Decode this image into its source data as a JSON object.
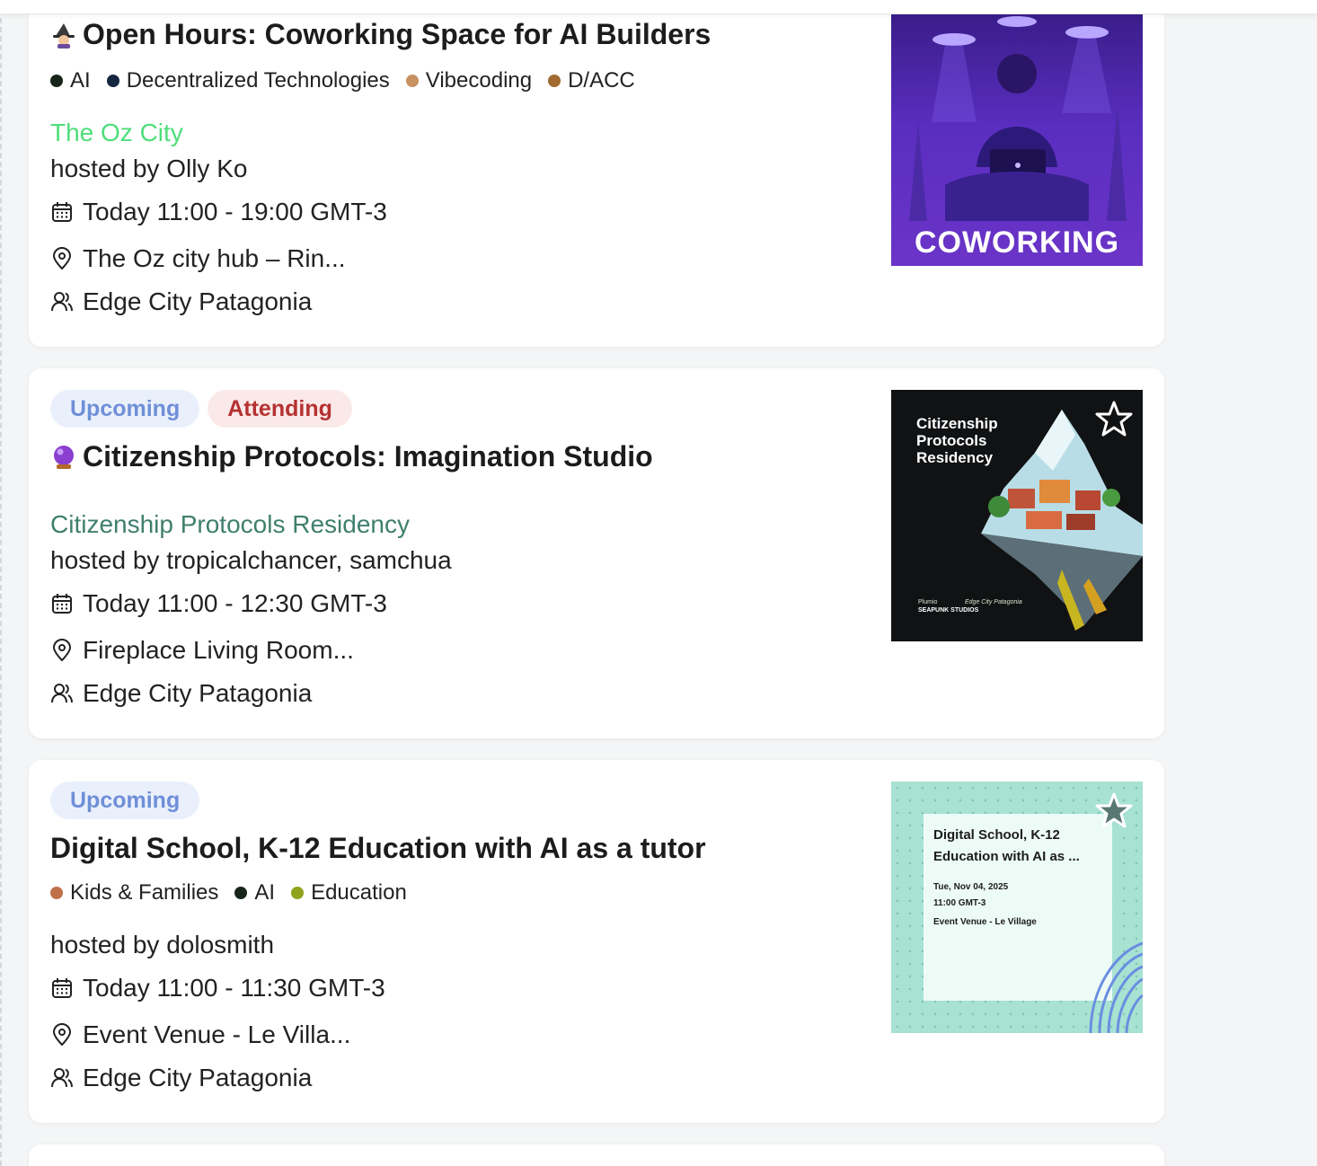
{
  "events": [
    {
      "title": "Open Hours: Coworking Space for AI Builders",
      "tags": [
        {
          "label": "AI",
          "color": "#17251a"
        },
        {
          "label": "Decentralized Technologies",
          "color": "#142640"
        },
        {
          "label": "Vibecoding",
          "color": "#c99060"
        },
        {
          "label": "D/ACC",
          "color": "#a06a30"
        }
      ],
      "organizer": "The Oz City",
      "organizer_color": "#4ede7a",
      "host": "hosted by Olly Ko",
      "time": "Today 11:00 - 19:00 GMT-3",
      "location": "The Oz city hub – Rin...",
      "community": "Edge City Patagonia",
      "image_text": "COWORKING"
    },
    {
      "badges": [
        "Upcoming",
        "Attending"
      ],
      "title": "Citizenship Protocols: Imagination Studio",
      "organizer": "Citizenship Protocols Residency",
      "organizer_color": "#3f7f6d",
      "host": "hosted by tropicalchancer, samchua",
      "time": "Today 11:00 - 12:30 GMT-3",
      "location": "Fireplace Living Room...",
      "community": "Edge City Patagonia",
      "image_text": "Citizenship Protocols Residency",
      "image_logo": [
        "Plumio",
        "Edge City Patagonia",
        "SEAPUNK STUDIOS"
      ]
    },
    {
      "badges": [
        "Upcoming"
      ],
      "title": "Digital School, K-12 Education with AI as a tutor",
      "tags": [
        {
          "label": "Kids & Families",
          "color": "#c0714a"
        },
        {
          "label": "AI",
          "color": "#17251a"
        },
        {
          "label": "Education",
          "color": "#8fa31c"
        }
      ],
      "host": "hosted by dolosmith",
      "time": "Today 11:00 - 11:30 GMT-3",
      "location": "Event Venue - Le Villa...",
      "community": "Edge City Patagonia",
      "image_title": "Digital School, K-12 Education with AI as ...",
      "image_date": "Tue, Nov 04, 2025",
      "image_time": "11:00 GMT-3",
      "image_venue": "Event Venue - Le Village"
    }
  ]
}
